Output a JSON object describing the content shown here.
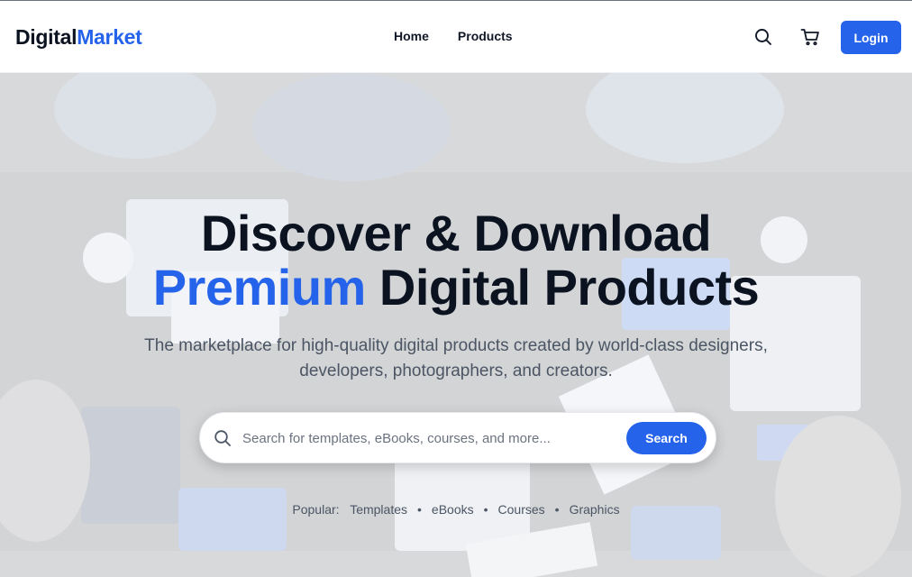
{
  "brand": {
    "part1": "Digital",
    "part2": "Market",
    "accent_color": "#2563eb"
  },
  "nav": {
    "links": [
      "Home",
      "Products"
    ]
  },
  "header_icons": {
    "search": "search-icon",
    "cart": "cart-icon"
  },
  "login_label": "Login",
  "hero": {
    "headline_line1": "Discover & Download",
    "headline_accent": "Premium",
    "headline_line2_rest": "Digital Products",
    "subtitle": "The marketplace for high-quality digital products created by world-class designers, developers, photographers, and creators.",
    "background": "photo of people working at a table with laptops, tablets and coffee cups, seen from above"
  },
  "search": {
    "placeholder": "Search for templates, eBooks, courses, and more...",
    "button_label": "Search"
  },
  "popular": {
    "label": "Popular:",
    "tags": [
      "Templates",
      "eBooks",
      "Courses",
      "Graphics"
    ],
    "separator": "•"
  }
}
